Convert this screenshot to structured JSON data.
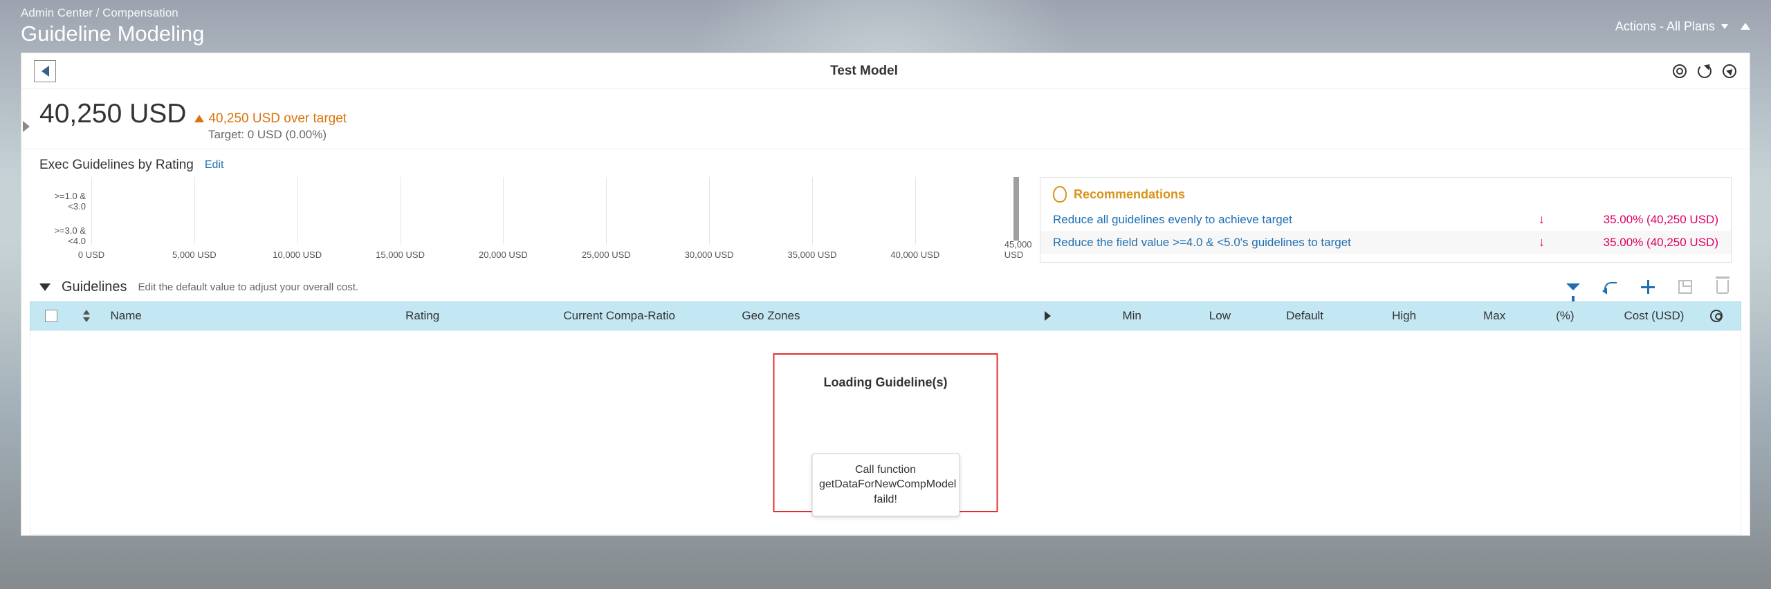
{
  "breadcrumb": "Admin Center / Compensation",
  "page_title": "Guideline Modeling",
  "header_actions": "Actions - All Plans",
  "model_name": "Test Model",
  "summary": {
    "amount": "40,250 USD",
    "delta": "40,250 USD over target",
    "target": "Target: 0 USD (0.00%)"
  },
  "chart_section": {
    "title": "Exec Guidelines by Rating",
    "edit": "Edit"
  },
  "chart_data": {
    "type": "bar",
    "orientation": "horizontal",
    "categories": [
      ">=1.0 & <3.0",
      ">=3.0 & <4.0"
    ],
    "values": [
      0,
      0
    ],
    "xlabel": "",
    "ylabel": "",
    "x_ticks": [
      "0 USD",
      "5,000 USD",
      "10,000 USD",
      "15,000 USD",
      "20,000 USD",
      "25,000 USD",
      "30,000 USD",
      "35,000 USD",
      "40,000 USD",
      "45,000 USD"
    ],
    "xlim": [
      0,
      45000
    ]
  },
  "recommendations": {
    "heading": "Recommendations",
    "items": [
      {
        "text": "Reduce all guidelines evenly to achieve target",
        "value": "35.00% (40,250 USD)"
      },
      {
        "text": "Reduce the field value >=4.0 & <5.0's guidelines to target",
        "value": "35.00% (40,250 USD)"
      }
    ]
  },
  "guidelines": {
    "title": "Guidelines",
    "desc": "Edit the default value to adjust your overall cost."
  },
  "columns": {
    "name": "Name",
    "rating": "Rating",
    "compa": "Current Compa-Ratio",
    "geo": "Geo Zones",
    "min": "Min",
    "low": "Low",
    "def": "Default",
    "high": "High",
    "max": "Max",
    "pct": "(%)",
    "cost": "Cost (USD)"
  },
  "loading": {
    "title": "Loading Guideline(s)",
    "error": "Call function getDataForNewCompModel faild!"
  }
}
